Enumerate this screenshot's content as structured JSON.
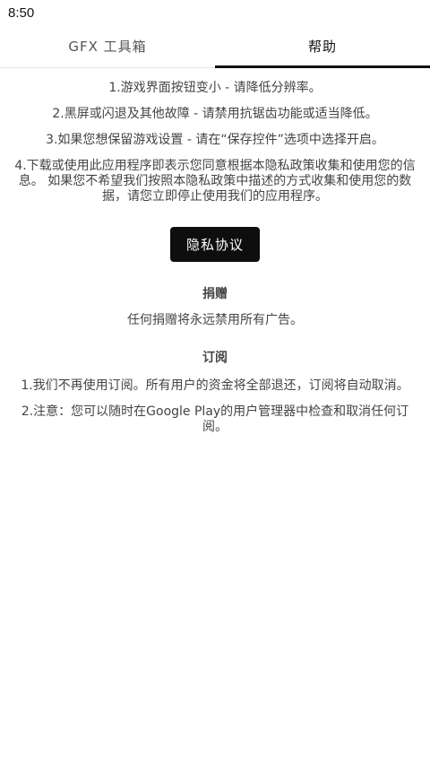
{
  "status_bar": {
    "time": "8:50"
  },
  "tabs": [
    {
      "label": "GFX 工具箱",
      "active": false
    },
    {
      "label": "帮助",
      "active": true
    }
  ],
  "help": {
    "items": [
      "1.游戏界面按钮变小 - 请降低分辨率。",
      "2.黑屏或闪退及其他故障 - 请禁用抗锯齿功能或适当降低。",
      "3.如果您想保留游戏设置 - 请在“保存控件”选项中选择开启。",
      "4.下载或使用此应用程序即表示您同意根据本隐私政策收集和使用您的信息。 如果您不希望我们按照本隐私政策中描述的方式收集和使用您的数据，请您立即停止使用我们的应用程序。"
    ],
    "privacy_button": "隐私协议"
  },
  "donate": {
    "title": "捐赠",
    "text": "任何捐赠将永远禁用所有广告。"
  },
  "subscription": {
    "title": "订阅",
    "items": [
      "1.我们不再使用订阅。所有用户的资金将全部退还，订阅将自动取消。",
      "2.注意：您可以随时在Google Play的用户管理器中检查和取消任何订阅。"
    ]
  },
  "colors": {
    "accent": "#111111",
    "button_bg": "#0e0e0e",
    "text": "#444444"
  }
}
